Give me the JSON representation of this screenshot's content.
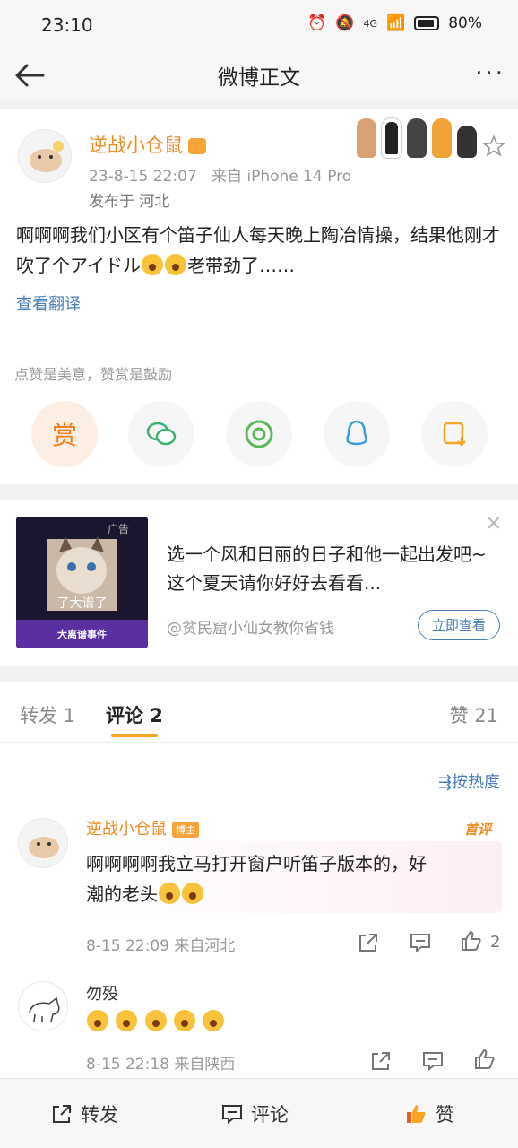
{
  "status": {
    "time": "23:10",
    "network": "4G",
    "battery": "80%"
  },
  "nav": {
    "title": "微博正文"
  },
  "post": {
    "author": "逆战小仓鼠",
    "date": "23-8-15 22:07",
    "source": "来自 iPhone 14 Pro",
    "location": "发布于 河北",
    "text_part1": "啊啊啊我们小区有个笛子仙人每天晚上陶冶情操，结果他刚才吹了个アイドル",
    "text_part2": "老带劲了……",
    "translate": "查看翻译",
    "reward_hint": "点赞是美意，赞赏是鼓励",
    "reward_label": "赏"
  },
  "ad": {
    "tag": "广告",
    "thumb_caption": "了大谱了",
    "thumb_label": "大离谱事件",
    "text": "选一个风和日丽的日子和他一起出发吧~这个夏天请你好好去看看...",
    "source": "@贫民窟小仙女教你省钱",
    "button": "立即查看"
  },
  "tabs": {
    "repost": "转发 1",
    "comment": "评论 2",
    "like": "赞 21"
  },
  "sort_label": "按热度",
  "comments": [
    {
      "name": "逆战小仓鼠",
      "badge": "博主",
      "tag": "首评",
      "text_line1": "啊啊啊啊我立马打开窗户听笛子版本的，好",
      "text_line2": "潮的老头",
      "meta": "8-15 22:09 来自河北",
      "likes": "2"
    },
    {
      "name": "勿殁",
      "meta": "8-15 22:18 来自陕西"
    }
  ],
  "bottom": {
    "repost": "转发",
    "comment": "评论",
    "like": "赞"
  },
  "colors": {
    "accent": "#f08a24",
    "link": "#4a7ebb",
    "like": "#f05a28"
  }
}
